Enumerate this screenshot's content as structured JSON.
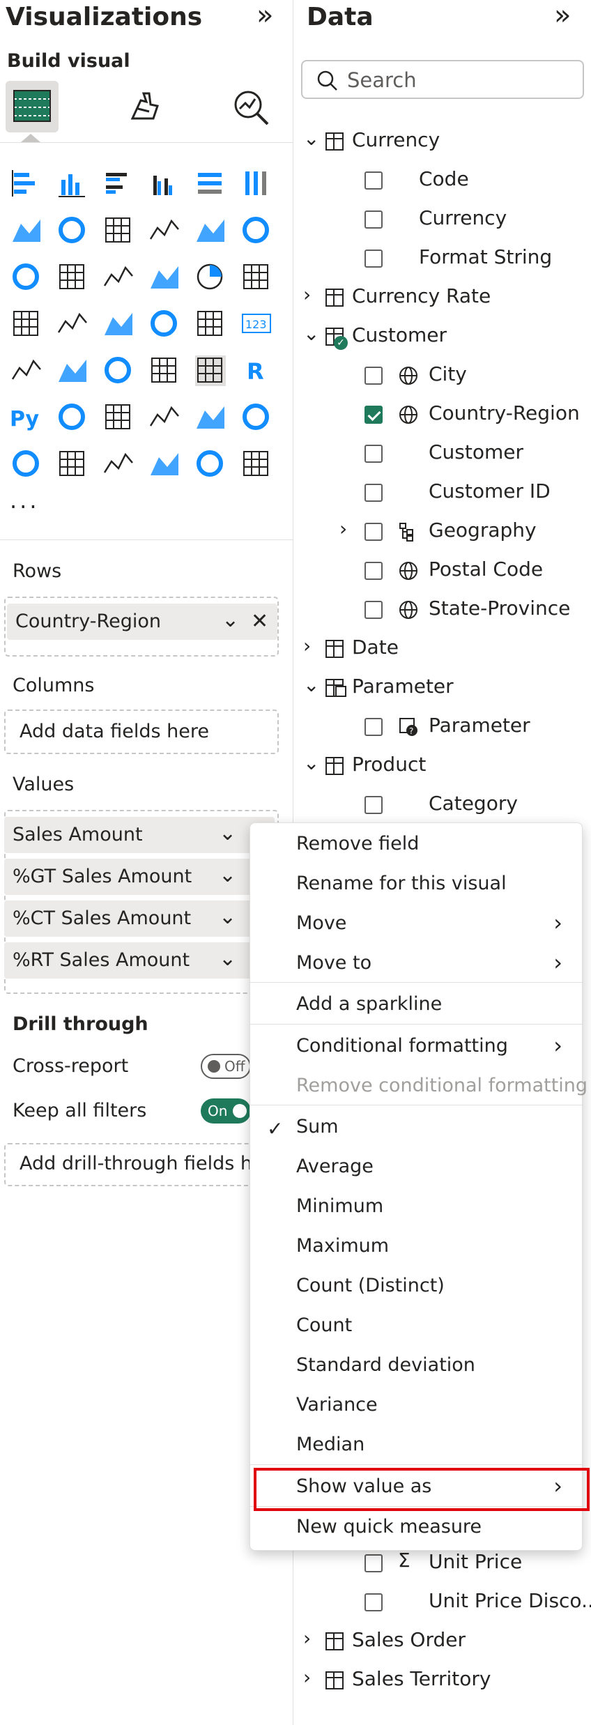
{
  "visualizations": {
    "title": "Visualizations",
    "build_visual": "Build visual",
    "more": "···",
    "rows_label": "Rows",
    "rows_field": "Country-Region",
    "columns_label": "Columns",
    "columns_placeholder": "Add data fields here",
    "values_label": "Values",
    "values_fields": [
      "Sales Amount",
      "%GT Sales Amount",
      "%CT Sales Amount",
      "%RT Sales Amount"
    ],
    "drill_through": "Drill through",
    "cross_report": "Cross-report",
    "cross_report_state": "Off",
    "keep_all_filters": "Keep all filters",
    "keep_all_filters_state": "On",
    "drill_placeholder": "Add drill-through fields he"
  },
  "data": {
    "title": "Data",
    "search_placeholder": "Search",
    "items": {
      "currency": "Currency",
      "code": "Code",
      "currency_field": "Currency",
      "format_string": "Format String",
      "currency_rate": "Currency Rate",
      "customer": "Customer",
      "city": "City",
      "country_region": "Country-Region",
      "customer_field": "Customer",
      "customer_id": "Customer ID",
      "geography": "Geography",
      "postal_code": "Postal Code",
      "state_province": "State-Province",
      "date": "Date",
      "parameter": "Parameter",
      "parameter_field": "Parameter",
      "product": "Product",
      "category": "Category",
      "unit_price": "Unit Price",
      "unit_price_disco": "Unit Price Disco...",
      "sales_order": "Sales Order",
      "sales_territory": "Sales Territory"
    }
  },
  "context_menu": {
    "remove_field": "Remove field",
    "rename": "Rename for this visual",
    "move": "Move",
    "move_to": "Move to",
    "add_sparkline": "Add a sparkline",
    "conditional_formatting": "Conditional formatting",
    "remove_conditional_formatting": "Remove conditional formatting",
    "sum": "Sum",
    "average": "Average",
    "minimum": "Minimum",
    "maximum": "Maximum",
    "count_distinct": "Count (Distinct)",
    "count": "Count",
    "std_dev": "Standard deviation",
    "variance": "Variance",
    "median": "Median",
    "show_value_as": "Show value as",
    "new_quick_measure": "New quick measure"
  },
  "colors": {
    "accent": "#1f7a5c",
    "highlight": "#e0000c",
    "icon_blue": "#118dff"
  }
}
